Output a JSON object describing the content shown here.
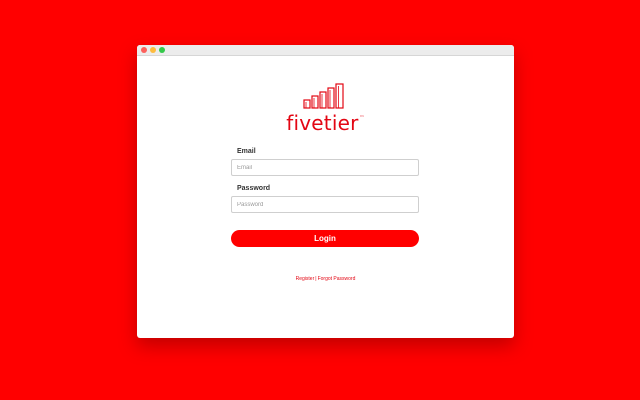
{
  "brand": {
    "name": "fivetier",
    "trademark": "™",
    "color": "#e30613"
  },
  "background_color": "#ff0000",
  "form": {
    "email_label": "Email",
    "email_placeholder": "Email",
    "password_label": "Password",
    "password_placeholder": "Password",
    "login_label": "Login"
  },
  "links": {
    "register": "Register",
    "separator": "|",
    "forgot_password": "Forgot Password"
  },
  "window_controls": [
    "close",
    "minimize",
    "maximize"
  ]
}
